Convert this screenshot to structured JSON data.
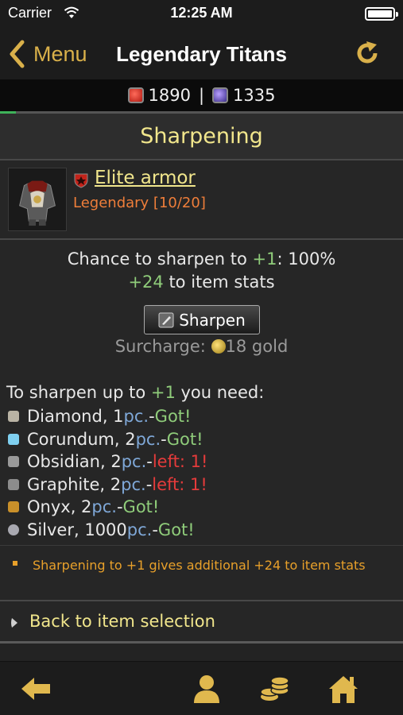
{
  "status_bar": {
    "carrier": "Carrier",
    "time": "12:25 AM"
  },
  "nav": {
    "back_label": "Menu",
    "title": "Legendary Titans",
    "accent_color": "#d9b04a"
  },
  "resources": {
    "red": "1890",
    "separator": "|",
    "purple": "1335",
    "progress_fraction": 0.04
  },
  "section_title": "Sharpening",
  "item": {
    "name": "Elite armor",
    "rarity": "Legendary [10/20]"
  },
  "chance": {
    "prefix": "Chance to sharpen to ",
    "level": "+1",
    "suffix": ": 100%",
    "bonus": "+24",
    "bonus_suffix": " to item stats"
  },
  "sharpen_button": "Sharpen",
  "surcharge": {
    "label": "Surcharge: ",
    "amount": "18 gold"
  },
  "requirements": {
    "prefix": "To sharpen up to ",
    "level": "+1",
    "suffix": " you need:",
    "materials": [
      {
        "name": "Diamond, 1 ",
        "unit": "pc.",
        "dash": " - ",
        "status": "Got!",
        "ok": true,
        "icon": "diamond-icon"
      },
      {
        "name": "Corundum, 2 ",
        "unit": "pc.",
        "dash": " - ",
        "status": "Got!",
        "ok": true,
        "icon": "corundum-icon"
      },
      {
        "name": "Obsidian, 2 ",
        "unit": "pc.",
        "dash": " - ",
        "status": "left: 1!",
        "ok": false,
        "icon": "obsidian-icon"
      },
      {
        "name": "Graphite, 2 ",
        "unit": "pc.",
        "dash": " - ",
        "status": "left: 1!",
        "ok": false,
        "icon": "graphite-icon"
      },
      {
        "name": "Onyx, 2 ",
        "unit": "pc.",
        "dash": " - ",
        "status": "Got!",
        "ok": true,
        "icon": "onyx-icon"
      },
      {
        "name": "Silver, 1000 ",
        "unit": "pc.",
        "dash": " - ",
        "status": "Got!",
        "ok": true,
        "icon": "silver-icon"
      }
    ]
  },
  "note": "Sharpening to +1 gives additional +24 to item stats",
  "back_link": "Back to item selection",
  "tabbar": {
    "icons": [
      "back-arrow-icon",
      "profile-icon",
      "coins-icon",
      "home-icon"
    ]
  }
}
